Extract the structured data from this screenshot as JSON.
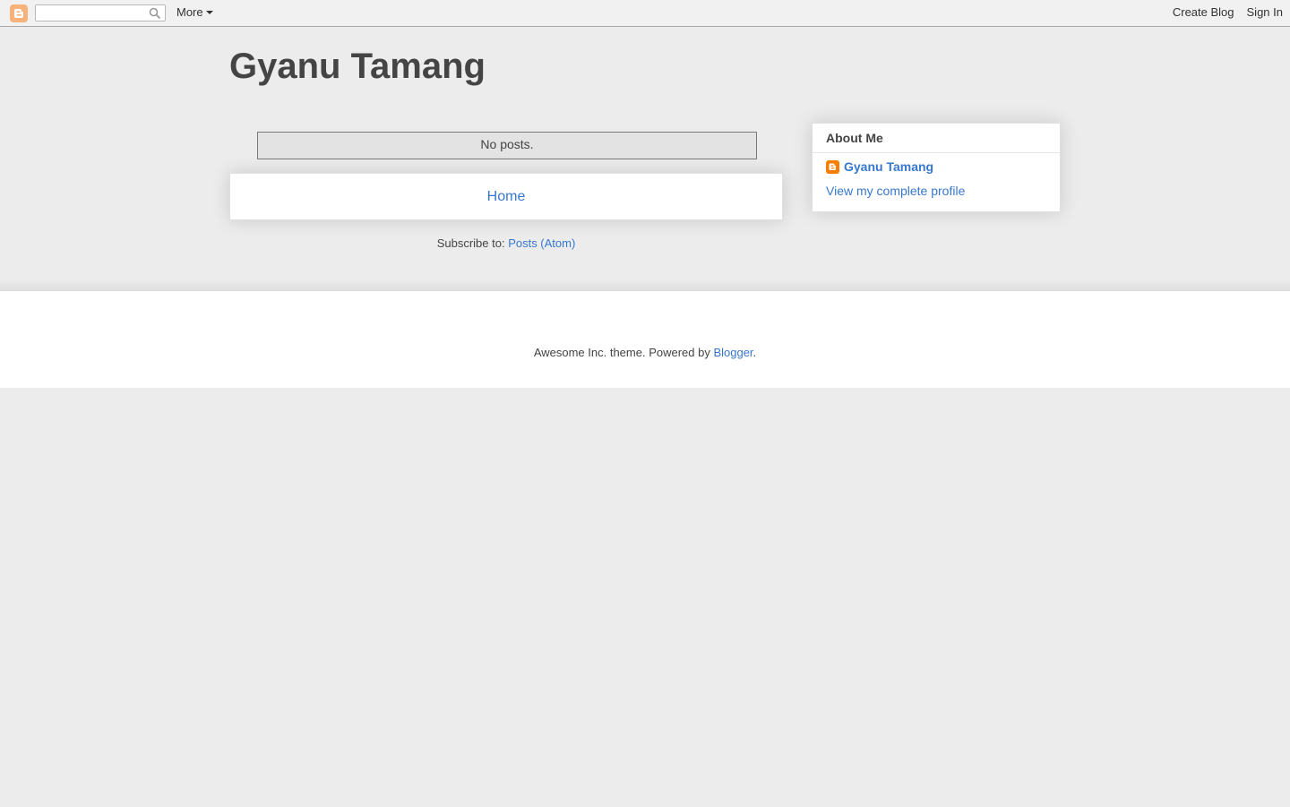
{
  "navbar": {
    "logo_icon": "blogger-icon",
    "search": {
      "value": "",
      "placeholder": ""
    },
    "search_icon": "search-icon",
    "more_label": "More",
    "create_blog_label": "Create Blog",
    "sign_in_label": "Sign In"
  },
  "header": {
    "title": "Gyanu Tamang"
  },
  "main": {
    "no_posts_text": "No posts.",
    "home_label": "Home",
    "subscribe_prefix": "Subscribe to: ",
    "subscribe_link": "Posts (Atom)"
  },
  "sidebar": {
    "about_title": "About Me",
    "profile_name": "Gyanu Tamang",
    "view_profile_label": "View my complete profile"
  },
  "footer": {
    "prefix": "Awesome Inc. theme. Powered by ",
    "blogger_link": "Blogger",
    "suffix": "."
  },
  "colors": {
    "link": "#3778cd",
    "background": "#ececec",
    "text": "#444444",
    "blogger_orange": "#f57d00"
  }
}
